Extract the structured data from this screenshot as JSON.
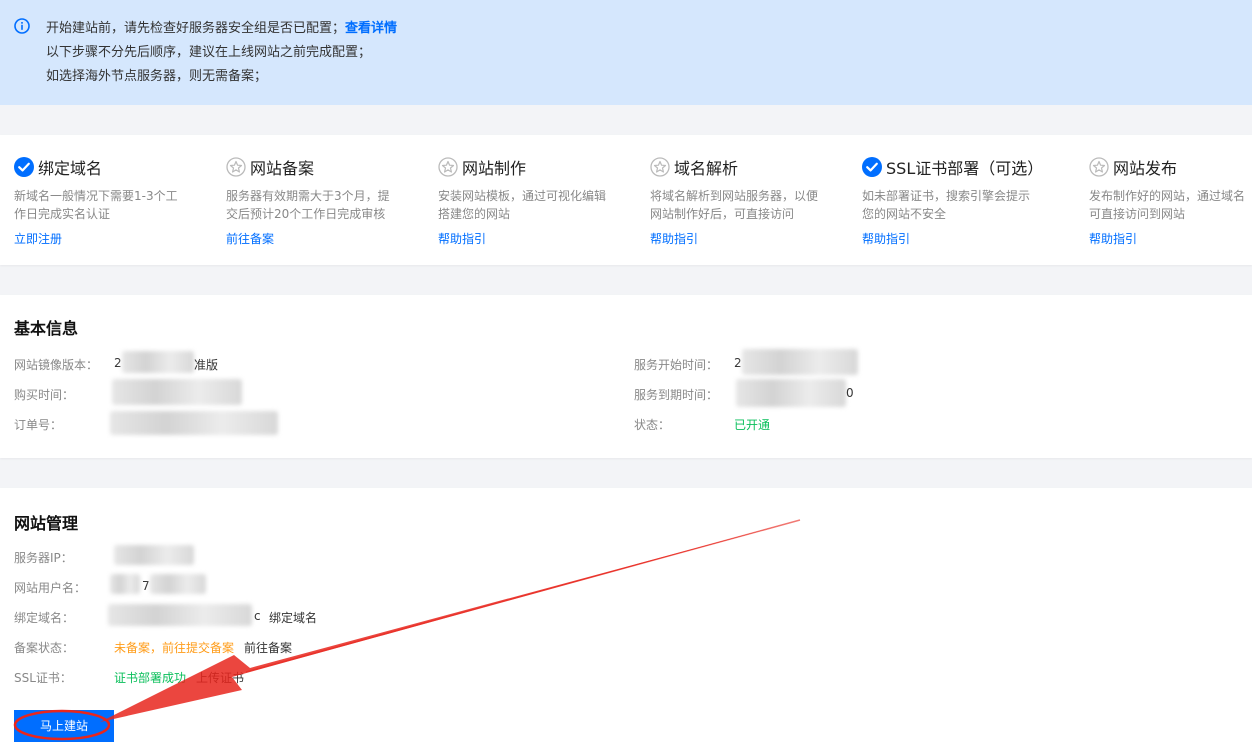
{
  "notice": {
    "line1": "开始建站前，请先检查好服务器安全组是否已配置；",
    "line1_link": "查看详情",
    "line2": "以下步骤不分先后顺序，建议在上线网站之前完成配置；",
    "line3": "如选择海外节点服务器，则无需备案；"
  },
  "steps": [
    {
      "title": "绑定域名",
      "icon": "check-circle-icon",
      "done": true,
      "desc": "新域名一般情况下需要1-3个工作日完成实名认证",
      "link": "立即注册"
    },
    {
      "title": "网站备案",
      "icon": "star-circle-icon",
      "done": false,
      "desc": "服务器有效期需大于3个月，提交后预计20个工作日完成审核",
      "link": "前往备案"
    },
    {
      "title": "网站制作",
      "icon": "star-circle-icon",
      "done": false,
      "desc": "安装网站模板，通过可视化编辑搭建您的网站",
      "link": "帮助指引"
    },
    {
      "title": "域名解析",
      "icon": "star-circle-icon",
      "done": false,
      "desc": "将域名解析到网站服务器，以便网站制作好后，可直接访问",
      "link": "帮助指引"
    },
    {
      "title": "SSL证书部署（可选）",
      "icon": "check-circle-icon",
      "done": true,
      "desc": "如未部署证书，搜索引擎会提示您的网站不安全",
      "link": "帮助指引"
    },
    {
      "title": "网站发布",
      "icon": "star-circle-icon",
      "done": false,
      "desc": "发布制作好的网站，通过域名可直接访问到网站",
      "link": "帮助指引"
    }
  ],
  "basic": {
    "title": "基本信息",
    "mirror_label": "网站镜像版本：",
    "mirror_value_prefix": "2",
    "mirror_value_suffix": "准版",
    "purchase_label": "购买时间：",
    "order_label": "订单号：",
    "start_label": "服务开始时间：",
    "start_value_prefix": "2",
    "end_label": "服务到期时间：",
    "end_value_suffix": "0",
    "status_label": "状态：",
    "status_value": "已开通"
  },
  "manage": {
    "title": "网站管理",
    "ip_label": "服务器IP：",
    "user_label": "网站用户名：",
    "user_partial": "7",
    "domain_label": "绑定域名：",
    "domain_suffix": "c",
    "domain_link": "绑定域名",
    "icp_label": "备案状态：",
    "icp_status": "未备案，前往提交备案",
    "icp_link": "前往备案",
    "ssl_label": "SSL证书：",
    "ssl_status": "证书部署成功",
    "ssl_link": "上传证书",
    "build_button": "马上建站"
  },
  "colors": {
    "accent": "#006eff",
    "success": "#0abf5b",
    "warning": "#ff9c19",
    "annotation_arrow": "#e8261d"
  }
}
